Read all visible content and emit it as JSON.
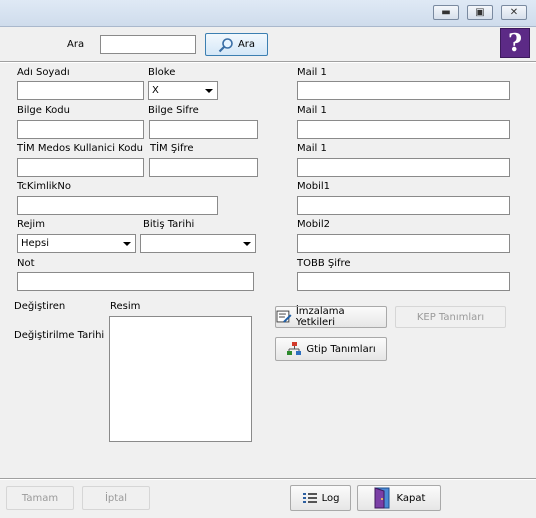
{
  "search": {
    "label": "Ara",
    "value": "",
    "button_label": "Ara"
  },
  "form": {
    "adi_soyadi_label": "Adı Soyadı",
    "bloke_label": "Bloke",
    "bloke_value": "X",
    "bilge_kodu_label": "Bilge Kodu",
    "bilge_sifre_label": "Bilge Sifre",
    "tim_medos_label": "TİM Medos Kullanici Kodu",
    "tim_sifre_label": "TİM Şifre",
    "tckimlik_label": "TcKimlikNo",
    "rejim_label": "Rejim",
    "rejim_value": "Hepsi",
    "bitis_tarihi_label": "Bitiş Tarihi",
    "bitis_tarihi_value": "",
    "not_label": "Not",
    "mail1_label_a": "Mail 1",
    "mail1_label_b": "Mail 1",
    "mail1_label_c": "Mail 1",
    "mobil1_label": "Mobil1",
    "mobil2_label": "Mobil2",
    "tobb_sifre_label": "TOBB Şifre",
    "degistiren_label": "Değiştiren",
    "degistirilme_label": "Değiştirilme Tarihi",
    "resim_label": "Resim"
  },
  "buttons": {
    "imzalama_label": "İmzalama Yetkileri",
    "kep_label": "KEP Tanımları",
    "gtip_label": "Gtip Tanımları",
    "tamam_label": "Tamam",
    "iptal_label": "İptal",
    "log_label": "Log",
    "kapat_label": "Kapat"
  },
  "colors": {
    "help_bg": "#5c2a86",
    "title_bar": "#dfe9f5"
  }
}
